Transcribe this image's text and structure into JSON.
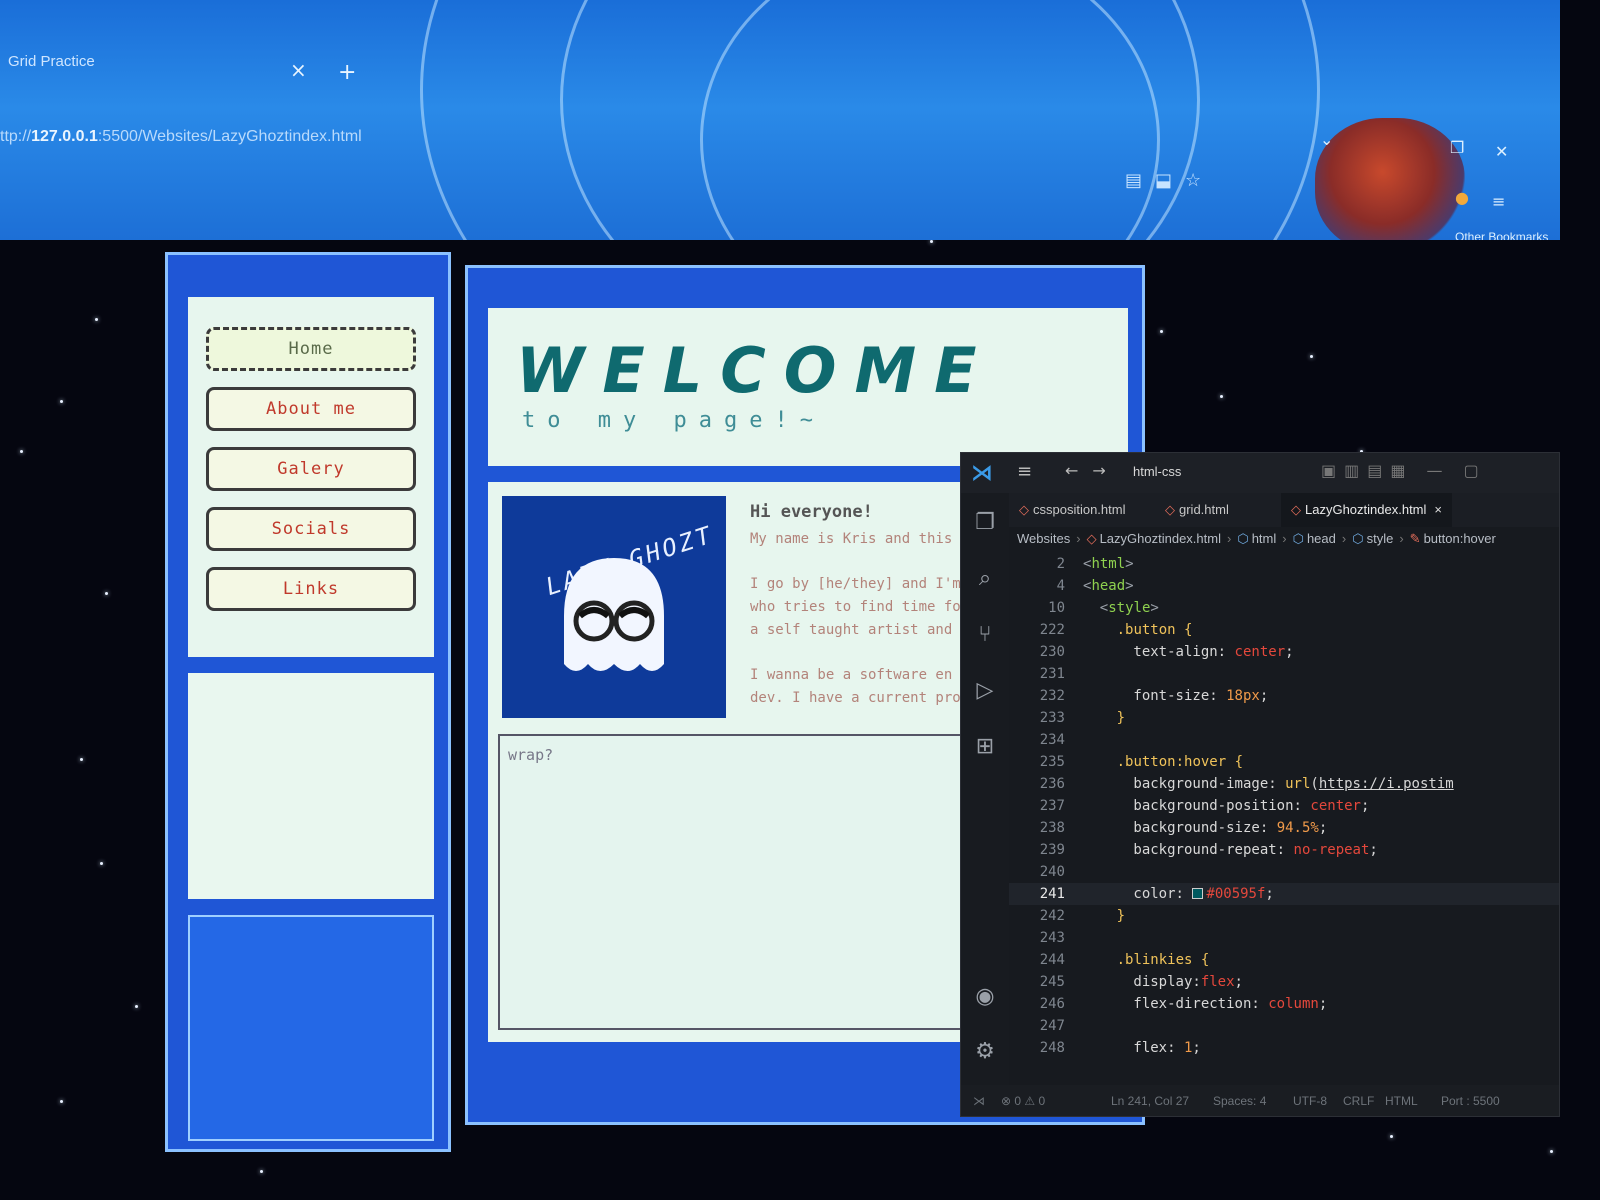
{
  "browser": {
    "tab_title": "Grid Practice",
    "tab_close": "×",
    "new_tab": "+",
    "url_prefix": "ttp://",
    "url_host": "127.0.0.1",
    "url_rest": ":5500/Websites/LazyGhoztindex.html",
    "other_bookmarks": "Other Bookmarks"
  },
  "site": {
    "nav": [
      {
        "label": "Home",
        "active": true
      },
      {
        "label": "About me",
        "active": false
      },
      {
        "label": "Galery",
        "active": false
      },
      {
        "label": "Socials",
        "active": false
      },
      {
        "label": "Links",
        "active": false
      }
    ],
    "welcome_title": "WELCOME",
    "welcome_subtitle": "to my page!~",
    "logo_text": "LAZY GHOZT",
    "intro": {
      "heading": "Hi everyone!",
      "lines": [
        "My name is Kris and this i",
        "",
        "I go by [he/they] and I'm ju",
        "who tries to find time fo",
        "a self taught artist and d",
        "",
        "I wanna be a software en",
        "dev. I have a current prod"
      ]
    },
    "wrap_label": "wrap?"
  },
  "vscode": {
    "title": "html-css",
    "tabs": [
      "cssposition.html",
      "grid.html",
      "LazyGhoztindex.html"
    ],
    "active_tab": "LazyGhoztindex.html",
    "tab_close": "×",
    "breadcrumb": [
      "Websites",
      "LazyGhoztindex.html",
      "html",
      "head",
      "style",
      "button:hover"
    ],
    "current_line": "241",
    "lines": [
      {
        "n": "2",
        "indent": 0,
        "tokens": [
          [
            "t-punct",
            "<"
          ],
          [
            "t-tag",
            "html"
          ],
          [
            "t-punct",
            ">"
          ]
        ]
      },
      {
        "n": "4",
        "indent": 0,
        "tokens": [
          [
            "t-punct",
            "<"
          ],
          [
            "t-tag",
            "head"
          ],
          [
            "t-punct",
            ">"
          ]
        ]
      },
      {
        "n": "10",
        "indent": 2,
        "tokens": [
          [
            "t-punct",
            "<"
          ],
          [
            "t-tag",
            "style"
          ],
          [
            "t-punct",
            ">"
          ]
        ]
      },
      {
        "n": "222",
        "indent": 4,
        "tokens": [
          [
            "t-sel",
            ".button "
          ],
          [
            "t-brace",
            "{"
          ]
        ]
      },
      {
        "n": "230",
        "indent": 6,
        "tokens": [
          [
            "t-prop",
            "text-align: "
          ],
          [
            "t-val",
            "center"
          ],
          [
            "t-prop",
            ";"
          ]
        ]
      },
      {
        "n": "231",
        "indent": 0,
        "tokens": []
      },
      {
        "n": "232",
        "indent": 6,
        "tokens": [
          [
            "t-prop",
            "font-size: "
          ],
          [
            "t-num",
            "18px"
          ],
          [
            "t-prop",
            ";"
          ]
        ]
      },
      {
        "n": "233",
        "indent": 4,
        "tokens": [
          [
            "t-brace",
            "}"
          ]
        ]
      },
      {
        "n": "234",
        "indent": 0,
        "tokens": []
      },
      {
        "n": "235",
        "indent": 4,
        "tokens": [
          [
            "t-sel",
            ".button:hover "
          ],
          [
            "t-brace",
            "{"
          ]
        ]
      },
      {
        "n": "236",
        "indent": 6,
        "tokens": [
          [
            "t-prop",
            "background-image: "
          ],
          [
            "t-sel",
            "url"
          ],
          [
            "t-prop",
            "("
          ],
          [
            "t-url",
            "https://i.postim"
          ]
        ]
      },
      {
        "n": "237",
        "indent": 6,
        "tokens": [
          [
            "t-prop",
            "background-position: "
          ],
          [
            "t-val",
            "center"
          ],
          [
            "t-prop",
            ";"
          ]
        ]
      },
      {
        "n": "238",
        "indent": 6,
        "tokens": [
          [
            "t-prop",
            "background-size: "
          ],
          [
            "t-num",
            "94.5%"
          ],
          [
            "t-prop",
            ";"
          ]
        ]
      },
      {
        "n": "239",
        "indent": 6,
        "tokens": [
          [
            "t-prop",
            "background-repeat: "
          ],
          [
            "t-val",
            "no-repeat"
          ],
          [
            "t-prop",
            ";"
          ]
        ]
      },
      {
        "n": "240",
        "indent": 0,
        "tokens": []
      },
      {
        "n": "241",
        "indent": 6,
        "tokens": [
          [
            "t-prop",
            "color: "
          ],
          [
            "swatch",
            ""
          ],
          [
            "t-val",
            "#00595f"
          ],
          [
            "t-prop",
            ";"
          ]
        ]
      },
      {
        "n": "242",
        "indent": 4,
        "tokens": [
          [
            "t-brace",
            "}"
          ]
        ]
      },
      {
        "n": "243",
        "indent": 0,
        "tokens": []
      },
      {
        "n": "244",
        "indent": 4,
        "tokens": [
          [
            "t-sel",
            ".blinkies "
          ],
          [
            "t-brace",
            "{"
          ]
        ]
      },
      {
        "n": "245",
        "indent": 6,
        "tokens": [
          [
            "t-prop",
            "display:"
          ],
          [
            "t-val",
            "flex"
          ],
          [
            "t-prop",
            ";"
          ]
        ]
      },
      {
        "n": "246",
        "indent": 6,
        "tokens": [
          [
            "t-prop",
            "flex-direction: "
          ],
          [
            "t-val",
            "column"
          ],
          [
            "t-prop",
            ";"
          ]
        ]
      },
      {
        "n": "247",
        "indent": 0,
        "tokens": []
      },
      {
        "n": "248",
        "indent": 6,
        "tokens": [
          [
            "t-prop",
            "flex: "
          ],
          [
            "t-num",
            "1"
          ],
          [
            "t-prop",
            ";"
          ]
        ]
      }
    ],
    "status": {
      "problems": "⊗ 0 ⚠ 0",
      "position": "Ln 241, Col 27",
      "spaces": "Spaces: 4",
      "encoding": "UTF-8",
      "eol": "CRLF",
      "language": "HTML",
      "port": "Port : 5500"
    }
  }
}
